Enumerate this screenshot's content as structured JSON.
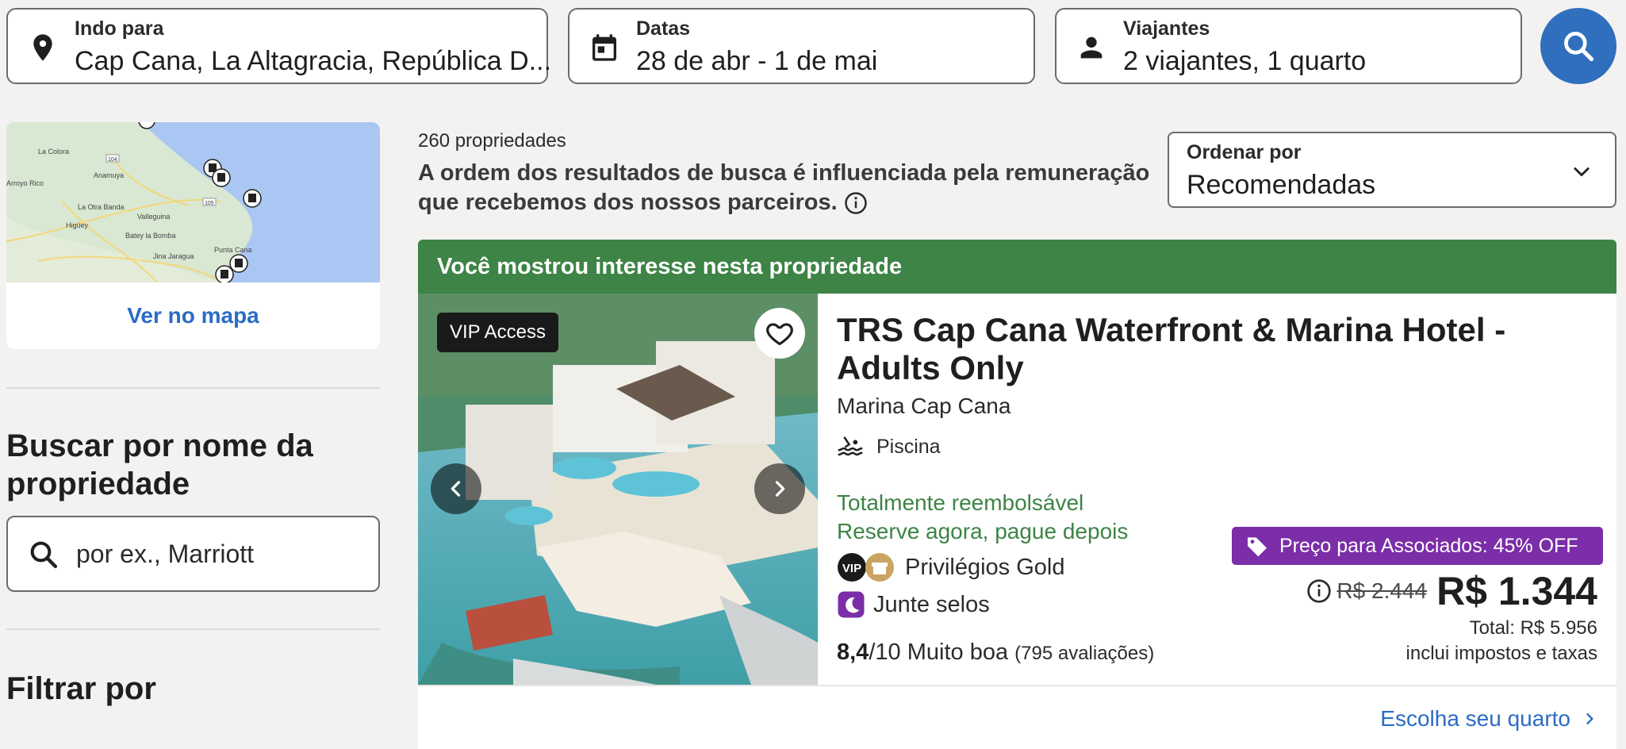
{
  "search": {
    "destination": {
      "label": "Indo para",
      "value": "Cap Cana, La Altagracia, República D..."
    },
    "dates": {
      "label": "Datas",
      "value": "28 de abr - 1 de mai"
    },
    "travelers": {
      "label": "Viajantes",
      "value": "2 viajantes, 1 quarto"
    }
  },
  "sidebar": {
    "map_labels": [
      "La Colora",
      "Anamuya",
      "Arroyo Rico",
      "La Otra Banda",
      "Higüey",
      "Valleguina",
      "Batey la Bomba",
      "Jina Jaragua",
      "Punta Cana",
      "104",
      "105"
    ],
    "map_link": "Ver no mapa",
    "search_name_heading": "Buscar por nome da propriedade",
    "search_name_placeholder": "por ex., Marriott",
    "filter_heading": "Filtrar por"
  },
  "results": {
    "count": "260 propriedades",
    "disclaimer": "A ordem dos resultados de busca é influenciada pela remuneração que recebemos dos nossos parceiros.",
    "sort": {
      "label": "Ordenar por",
      "value": "Recomendadas"
    }
  },
  "property": {
    "banner": "Você mostrou interesse nesta propriedade",
    "vip_badge": "VIP Access",
    "name": "TRS Cap Cana Waterfront & Marina Hotel - Adults Only",
    "location": "Marina Cap Cana",
    "amenity": "Piscina",
    "refundable": "Totalmente reembolsável",
    "pay_later": "Reserve agora, pague depois",
    "vip_mark": "VIP",
    "loyalty": "Privilégios Gold",
    "stamps": "Junte selos",
    "rating_score": "8,4",
    "rating_scale": "/10",
    "rating_text": "Muito boa",
    "rating_reviews": "(795 avaliações)",
    "member_price": "Preço para Associados: 45% OFF",
    "old_price": "R$ 2.444",
    "price": "R$ 1.344",
    "total": "Total: R$ 5.956",
    "taxes": "inclui impostos e taxas",
    "choose_room": "Escolha seu quarto"
  },
  "colors": {
    "accent_blue": "#2f6fbe",
    "banner_green": "#3d8446",
    "member_purple": "#7b2ea8"
  }
}
